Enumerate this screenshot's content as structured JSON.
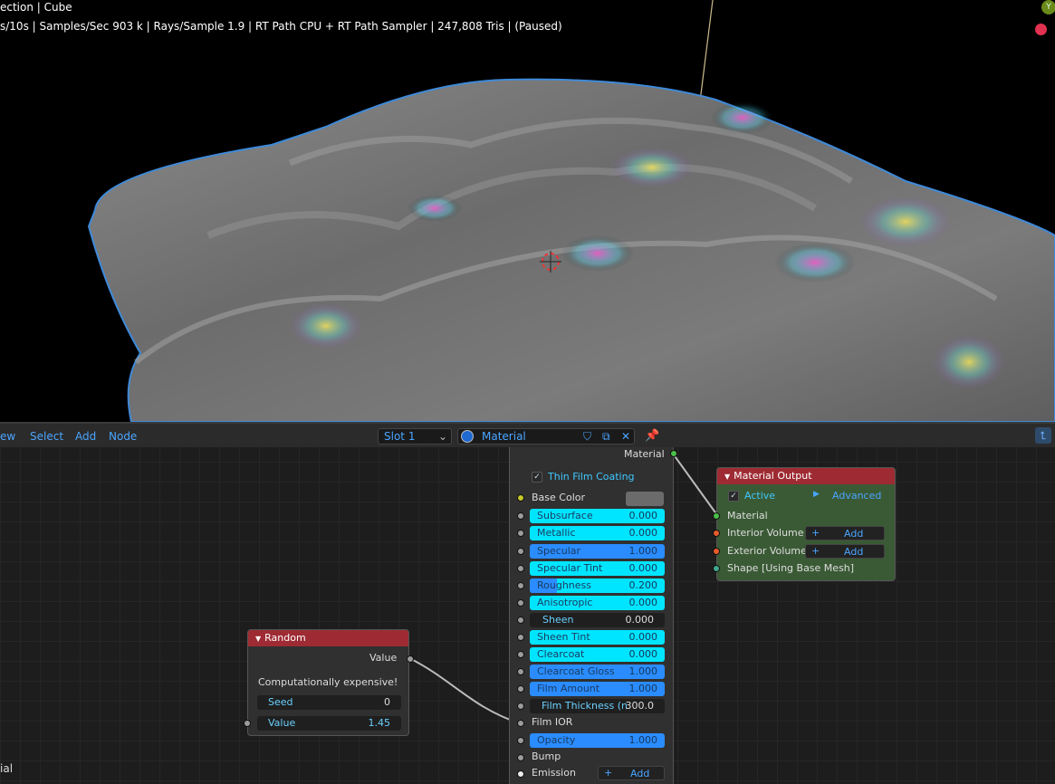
{
  "viewport": {
    "line1": "ection | Cube",
    "line2": "s/10s | Samples/Sec 903 k | Rays/Sample 1.9 | RT Path CPU + RT Path Sampler | 247,808 Tris | (Paused)",
    "gizmo_label": "Y"
  },
  "header": {
    "menus": [
      "ew",
      "Select",
      "Add",
      "Node"
    ],
    "slot": "Slot 1",
    "material_name": "Material"
  },
  "principled": {
    "output_label": "Material",
    "thin_film_label": "Thin Film Coating",
    "base_color_label": "Base Color",
    "subsurface": {
      "label": "Subsurface",
      "value": "0.000",
      "fill": 1.0
    },
    "metallic": {
      "label": "Metallic",
      "value": "0.000",
      "fill": 1.0
    },
    "specular": {
      "label": "Specular",
      "value": "1.000",
      "fill": 1.0
    },
    "specular_tint": {
      "label": "Specular Tint",
      "value": "0.000",
      "fill": 1.0
    },
    "roughness": {
      "label": "Roughness",
      "value": "0.200",
      "fill": 0.2
    },
    "anisotropic": {
      "label": "Anisotropic",
      "value": "0.000",
      "fill": 1.0
    },
    "sheen": {
      "label": "Sheen",
      "value": "0.000",
      "fill": 0.0
    },
    "sheen_tint": {
      "label": "Sheen Tint",
      "value": "0.000",
      "fill": 1.0
    },
    "clearcoat": {
      "label": "Clearcoat",
      "value": "0.000",
      "fill": 1.0
    },
    "clearcoat_gloss": {
      "label": "Clearcoat Gloss",
      "value": "1.000",
      "fill": 1.0
    },
    "film_amount": {
      "label": "Film Amount",
      "value": "1.000",
      "fill": 1.0
    },
    "film_thickness": {
      "label": "Film Thickness (n",
      "value": "300.0",
      "fill": 0.0
    },
    "film_ior_label": "Film IOR",
    "opacity": {
      "label": "Opacity",
      "value": "1.000",
      "fill": 1.0
    },
    "bump_label": "Bump",
    "emission_label": "Emission",
    "emission_add": "Add"
  },
  "material_output": {
    "title": "Material Output",
    "active_label": "Active",
    "advanced_label": "Advanced",
    "material_label": "Material",
    "interior_label": "Interior Volume",
    "exterior_label": "Exterior Volume",
    "add_label": "Add",
    "shape_label": "Shape [Using Base Mesh]"
  },
  "random_node": {
    "title": "Random",
    "value_out": "Value",
    "warning": "Computationally expensive!",
    "seed": {
      "label": "Seed",
      "value": "0"
    },
    "value": {
      "label": "Value",
      "value": "1.45"
    }
  },
  "footer_text": "ial",
  "colors": {
    "cyan": "#00e5ff",
    "blue": "#2a8cff",
    "node_red": "#9e2b33",
    "output_green": "#3a5a35"
  }
}
